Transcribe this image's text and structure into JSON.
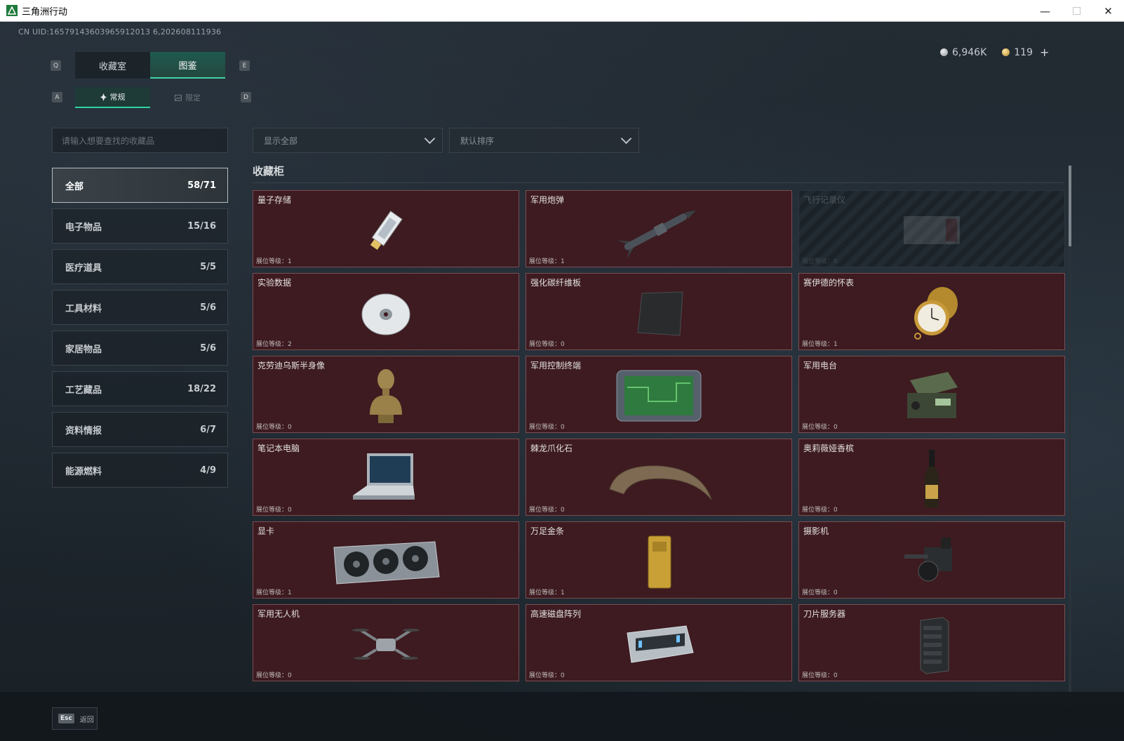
{
  "window": {
    "title": "三角洲行动",
    "minimize": "—",
    "maximize": "☐",
    "close": "✕"
  },
  "uid": "CN UID:16579143603965912013 6,202608111936",
  "currency": {
    "silver": "6,946K",
    "gold": "119",
    "plus": "+"
  },
  "tabs": {
    "main": [
      {
        "label": "收藏室",
        "active": false
      },
      {
        "label": "图鉴",
        "active": true
      }
    ],
    "main_keys": {
      "left": "Q",
      "right": "E"
    },
    "sub": [
      {
        "label": "常规",
        "active": true
      },
      {
        "label": "限定",
        "active": false
      }
    ],
    "sub_keys": {
      "left": "A",
      "right": "D"
    }
  },
  "search": {
    "placeholder": "请输入想要查找的收藏品"
  },
  "filters": {
    "show": "显示全部",
    "sort": "默认排序"
  },
  "categories": [
    {
      "label": "全部",
      "count": "58/71",
      "active": true
    },
    {
      "label": "电子物品",
      "count": "15/16"
    },
    {
      "label": "医疗道具",
      "count": "5/5"
    },
    {
      "label": "工具材料",
      "count": "5/6"
    },
    {
      "label": "家居物品",
      "count": "5/6"
    },
    {
      "label": "工艺藏品",
      "count": "18/22"
    },
    {
      "label": "资料情报",
      "count": "6/7"
    },
    {
      "label": "能源燃料",
      "count": "4/9"
    }
  ],
  "section_title": "收藏柜",
  "items": [
    {
      "name": "量子存储",
      "level": "展位等级：1",
      "icon": "usb-drive-icon",
      "locked": false
    },
    {
      "name": "军用炮弹",
      "level": "展位等级：1",
      "icon": "missile-icon",
      "locked": false
    },
    {
      "name": "飞行记录仪",
      "level": "展位等级：0",
      "icon": "flight-recorder-icon",
      "locked": true
    },
    {
      "name": "实验数据",
      "level": "展位等级：2",
      "icon": "disc-icon",
      "locked": false
    },
    {
      "name": "强化碳纤维板",
      "level": "展位等级：0",
      "icon": "carbon-plate-icon",
      "locked": false
    },
    {
      "name": "赛伊德的怀表",
      "level": "展位等级：1",
      "icon": "pocket-watch-icon",
      "locked": false
    },
    {
      "name": "克劳迪乌斯半身像",
      "level": "展位等级：0",
      "icon": "bust-icon",
      "locked": false
    },
    {
      "name": "军用控制终端",
      "level": "展位等级：0",
      "icon": "control-terminal-icon",
      "locked": false
    },
    {
      "name": "军用电台",
      "level": "展位等级：0",
      "icon": "radio-icon",
      "locked": false
    },
    {
      "name": "笔记本电脑",
      "level": "展位等级：0",
      "icon": "laptop-icon",
      "locked": false
    },
    {
      "name": "棘龙爪化石",
      "level": "展位等级：0",
      "icon": "claw-fossil-icon",
      "locked": false
    },
    {
      "name": "奥莉薇娅香槟",
      "level": "展位等级：0",
      "icon": "champagne-icon",
      "locked": false
    },
    {
      "name": "显卡",
      "level": "展位等级：1",
      "icon": "gpu-icon",
      "locked": false
    },
    {
      "name": "万足金条",
      "level": "展位等级：1",
      "icon": "gold-bar-icon",
      "locked": false
    },
    {
      "name": "摄影机",
      "level": "展位等级：0",
      "icon": "camera-icon",
      "locked": false
    },
    {
      "name": "军用无人机",
      "level": "展位等级：0",
      "icon": "drone-icon",
      "locked": false
    },
    {
      "name": "高速磁盘阵列",
      "level": "展位等级：0",
      "icon": "disk-array-icon",
      "locked": false
    },
    {
      "name": "刀片服务器",
      "level": "展位等级：0",
      "icon": "server-icon",
      "locked": false
    }
  ],
  "bottom": {
    "esc_key": "Esc",
    "esc_label": "返回"
  }
}
